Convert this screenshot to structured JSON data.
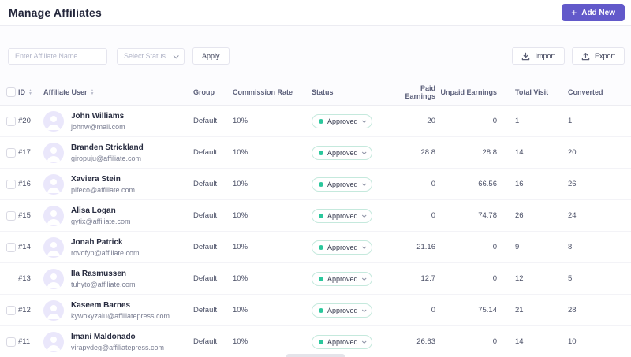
{
  "page": {
    "title": "Manage Affiliates"
  },
  "header": {
    "add_new_label": "Add New",
    "plus": "+"
  },
  "filters": {
    "name_placeholder": "Enter Affiliate Name",
    "status_placeholder": "Select Status",
    "apply_label": "Apply",
    "import_label": "Import",
    "export_label": "Export"
  },
  "colors": {
    "accent": "#6259CA",
    "status_dot": "#2BC79C",
    "status_border": "#C5E9DD"
  },
  "sort_icons": {
    "up": "▲",
    "down": "▼"
  },
  "table": {
    "columns": {
      "id": "ID",
      "user": "Affiliate User",
      "group": "Group",
      "rate": "Commission Rate",
      "status": "Status",
      "paid": "Paid Earnings",
      "unpaid": "Unpaid Earnings",
      "visits": "Total Visit",
      "converted": "Converted"
    },
    "rows": [
      {
        "id": "#20",
        "name": "John Williams",
        "email": "johnw@mail.com",
        "group": "Default",
        "rate": "10%",
        "status": "Approved",
        "paid": "20",
        "unpaid": "0",
        "visits": "1",
        "converted": "1",
        "has_checkbox": true
      },
      {
        "id": "#17",
        "name": "Branden Strickland",
        "email": "giropuju@affiliate.com",
        "group": "Default",
        "rate": "10%",
        "status": "Approved",
        "paid": "28.8",
        "unpaid": "28.8",
        "visits": "14",
        "converted": "20",
        "has_checkbox": true
      },
      {
        "id": "#16",
        "name": "Xaviera Stein",
        "email": "pifeco@affiliate.com",
        "group": "Default",
        "rate": "10%",
        "status": "Approved",
        "paid": "0",
        "unpaid": "66.56",
        "visits": "16",
        "converted": "26",
        "has_checkbox": true
      },
      {
        "id": "#15",
        "name": "Alisa Logan",
        "email": "gytix@affiliate.com",
        "group": "Default",
        "rate": "10%",
        "status": "Approved",
        "paid": "0",
        "unpaid": "74.78",
        "visits": "26",
        "converted": "24",
        "has_checkbox": true
      },
      {
        "id": "#14",
        "name": "Jonah Patrick",
        "email": "rovofyp@affiliate.com",
        "group": "Default",
        "rate": "10%",
        "status": "Approved",
        "paid": "21.16",
        "unpaid": "0",
        "visits": "9",
        "converted": "8",
        "has_checkbox": true
      },
      {
        "id": "#13",
        "name": "Ila Rasmussen",
        "email": "tuhyto@affiliate.com",
        "group": "Default",
        "rate": "10%",
        "status": "Approved",
        "paid": "12.7",
        "unpaid": "0",
        "visits": "12",
        "converted": "5",
        "has_checkbox": false
      },
      {
        "id": "#12",
        "name": "Kaseem Barnes",
        "email": "kywoxyzalu@affiliatepress.com",
        "group": "Default",
        "rate": "10%",
        "status": "Approved",
        "paid": "0",
        "unpaid": "75.14",
        "visits": "21",
        "converted": "28",
        "has_checkbox": true
      },
      {
        "id": "#11",
        "name": "Imani Maldonado",
        "email": "virapydeg@affiliatepress.com",
        "group": "Default",
        "rate": "10%",
        "status": "Approved",
        "paid": "26.63",
        "unpaid": "0",
        "visits": "14",
        "converted": "10",
        "has_checkbox": true
      }
    ]
  }
}
